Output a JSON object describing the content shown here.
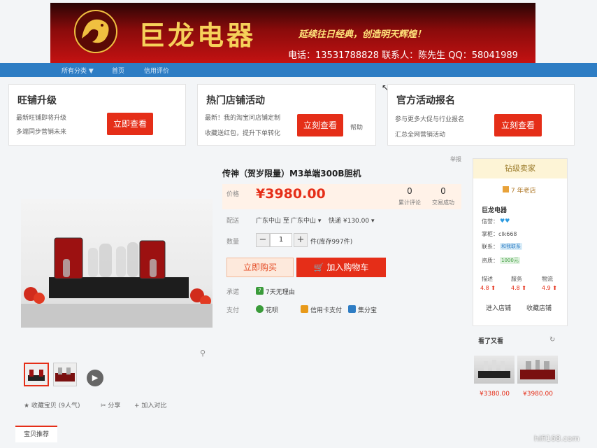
{
  "banner": {
    "shop_name": "巨龙电器",
    "slogan": "延续往日经典，创造明天辉煌！",
    "contact": "电话：13531788828  联系人：陈先生  QQ：58041989"
  },
  "nav": {
    "items": [
      "所有分类 ▼",
      "首页",
      "信用评价"
    ]
  },
  "promos": [
    {
      "title": "旺铺升级",
      "lines": [
        "最新旺铺即将升级",
        "多端同步营销未来"
      ],
      "button": "立即查看"
    },
    {
      "title": "热门店铺活动",
      "lines": [
        "最新！我的淘宝问店铺定制",
        "收藏送红包，提升下单转化"
      ],
      "button": "立刻查看",
      "extra": "帮助"
    },
    {
      "title": "官方活动报名",
      "lines": [
        "参与更多大促与行业报名",
        "汇总全网营销活动"
      ],
      "button": "立刻查看"
    }
  ],
  "product": {
    "report": "举报",
    "title": "传神（贺岁限量）M3单端300B胆机",
    "price_label": "价格",
    "price": "¥3980.00",
    "stats": [
      {
        "num": "0",
        "label": "累计评论"
      },
      {
        "num": "0",
        "label": "交易成功"
      }
    ],
    "shipping_label": "配送",
    "shipping_from": "广东中山 至",
    "shipping_to": "广东中山 ▾",
    "shipping_fee": "快递 ¥130.00 ▾",
    "qty_label": "数量",
    "qty_minus": "−",
    "qty_value": "1",
    "qty_plus": "+",
    "stock": "件(库存997件)",
    "buy_now": "立即购买",
    "add_to_cart": "加入购物车",
    "promise_label": "承诺",
    "promise_icon": "7",
    "promise": "7天无理由",
    "pay_label": "支付",
    "payments": [
      "花呗",
      "信用卡支付",
      "集分宝"
    ],
    "zoom_icon": "⚲",
    "play_icon": "▶",
    "actions": {
      "favorite": "★ 收藏宝贝 (9人气)",
      "share": "✂ 分享",
      "compare": "+ 加入对比"
    },
    "bottom_tab": "宝贝推荐"
  },
  "shop": {
    "header": "钻级卖家",
    "years": "7 年老店",
    "name": "巨龙电器",
    "credit_label": "信誉：",
    "credit_icons": "♥♥",
    "owner": "掌柜：clk668",
    "contact_label": "联系：",
    "contact_badge": "和我联系",
    "qual_label": "资质：",
    "qual_badge": "1000元",
    "ratings": [
      {
        "label": "描述",
        "score": "4.8 ⬆"
      },
      {
        "label": "服务",
        "score": "4.8 ⬆"
      },
      {
        "label": "物流",
        "score": "4.9 ⬆"
      }
    ],
    "enter_shop": "进入店铺",
    "favorite_shop": "收藏店铺"
  },
  "also_viewed": {
    "title": "看了又看",
    "refresh_icon": "↻",
    "prices": [
      "¥3380.00",
      "¥3980.00"
    ]
  },
  "watermark": "hifi168.com",
  "colors": {
    "accent": "#e52e18",
    "nav": "#2e7dc4",
    "banner": "#8a0b0b"
  }
}
